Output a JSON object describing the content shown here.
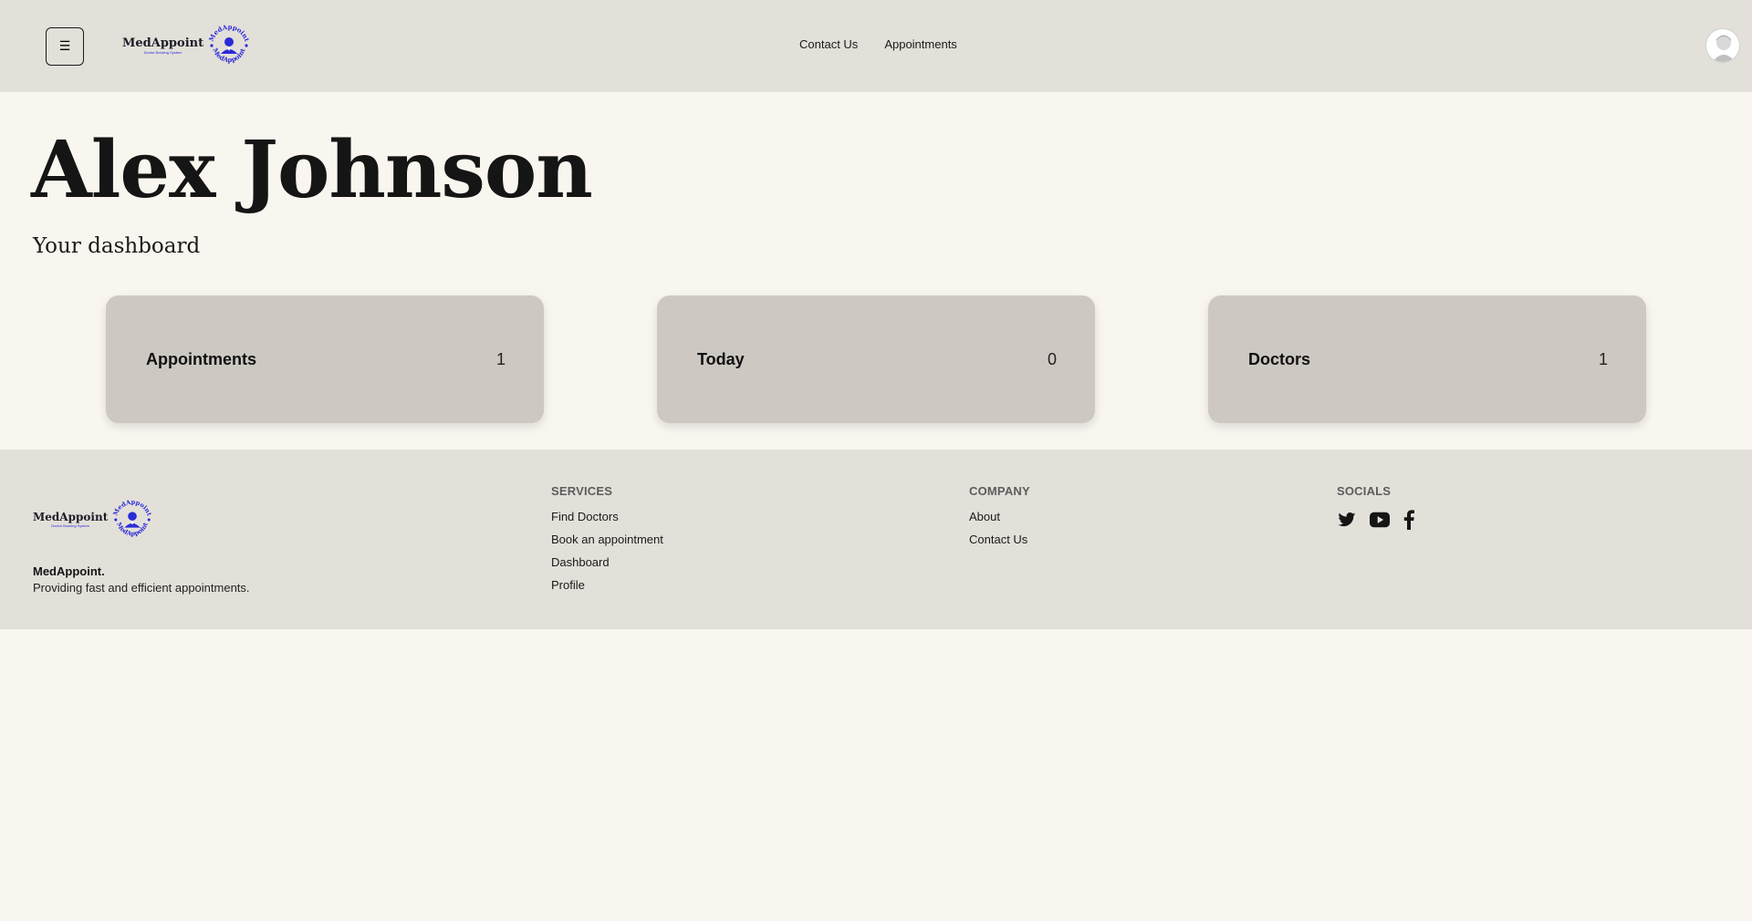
{
  "header": {
    "menu_icon": "☰",
    "logo": {
      "name": "MedAppoint",
      "tagline": "Doctor Booking System",
      "ring_text": "MedAppoint",
      "accent": "#2b2bd8"
    },
    "nav": [
      {
        "label": "Contact Us"
      },
      {
        "label": "Appointments"
      }
    ]
  },
  "main": {
    "title": "Alex Johnson",
    "subtitle": "Your dashboard",
    "cards": [
      {
        "label": "Appointments",
        "value": "1"
      },
      {
        "label": "Today",
        "value": "0"
      },
      {
        "label": "Doctors",
        "value": "1"
      }
    ]
  },
  "footer": {
    "brand": "MedAppoint.",
    "description": "Providing fast and efficient appointments.",
    "services": {
      "heading": "SERVICES",
      "links": [
        "Find Doctors",
        "Book an appointment",
        "Dashboard",
        "Profile"
      ]
    },
    "company": {
      "heading": "COMPANY",
      "links": [
        "About",
        "Contact Us"
      ]
    },
    "socials": {
      "heading": "SOCIALS",
      "icons": [
        "twitter-icon",
        "youtube-icon",
        "facebook-icon"
      ]
    }
  },
  "colors": {
    "header_bg": "#e3e0da",
    "page_bg": "#f8f6ef",
    "card_bg": "#cdc9c2",
    "logo_accent": "#2b2bd8"
  }
}
